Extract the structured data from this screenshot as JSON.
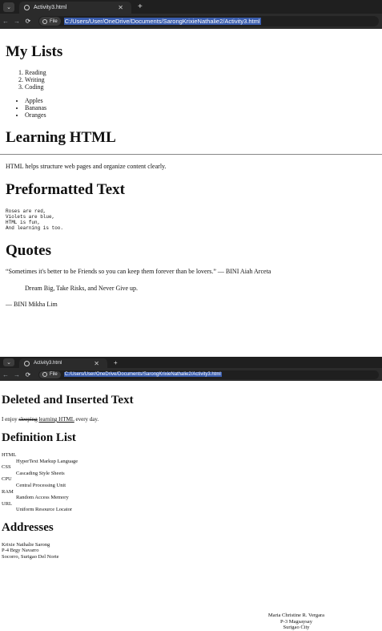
{
  "browser1": {
    "tab_title": "Activity3.html",
    "file_label": "File",
    "url": "C:/Users/User/OneDrive/Documents/SarongKrixieNathalie2/Activity3.html",
    "new_tab_symbol": "+"
  },
  "page1": {
    "lists_heading": "My Lists",
    "ordered": [
      "Reading",
      "Writing",
      "Coding"
    ],
    "unordered": [
      "Apples",
      "Bananas",
      "Oranges"
    ],
    "learning_heading": "Learning HTML",
    "learning_text": "HTML helps structure web pages and organize content clearly.",
    "pre_heading": "Preformatted Text",
    "pre_lines": [
      "Roses are red,",
      "Violets are blue,",
      "HTML is fun,",
      "And learning is too."
    ],
    "quotes_heading": "Quotes",
    "quote1": "“Sometimes it's better to be Friends so you can keep them forever than be lovers.” — BINI Aiah Arceta",
    "quote2": "Dream Big, Take Risks, and Never Give up.",
    "quote2_author": "— BINI Mikha Lim"
  },
  "browser2": {
    "tab_title": "Activity3.html",
    "file_label": "File",
    "url": "C:/Users/User/OneDrive/Documents/SarongKrixieNathalie2/Activity3.html",
    "new_tab_symbol": "+"
  },
  "page2": {
    "del_ins_heading": "Deleted and Inserted Text",
    "sentence_start": "I enjoy",
    "deleted_word": "sleeping",
    "inserted_word": "learning HTML",
    "sentence_end": "every day.",
    "def_heading": "Definition List",
    "definitions": [
      {
        "term": "HTML",
        "desc": "HyperText Markup Language"
      },
      {
        "term": "CSS",
        "desc": "Cascading Style Sheets"
      },
      {
        "term": "CPU",
        "desc": "Central Processing Unit"
      },
      {
        "term": "RAM",
        "desc": "Random Access Memory"
      },
      {
        "term": "URL",
        "desc": "Uniform Resource Locator"
      }
    ],
    "addr_heading": "Addresses",
    "address1": [
      "Krixie Nathalie Sarong",
      "P-4 Brgy Navarro",
      "Socorro, Surigao Del Norte"
    ],
    "address2": [
      "Maria Christine R. Vergara",
      "P-3 Magsaysay",
      "Surigao City"
    ]
  }
}
